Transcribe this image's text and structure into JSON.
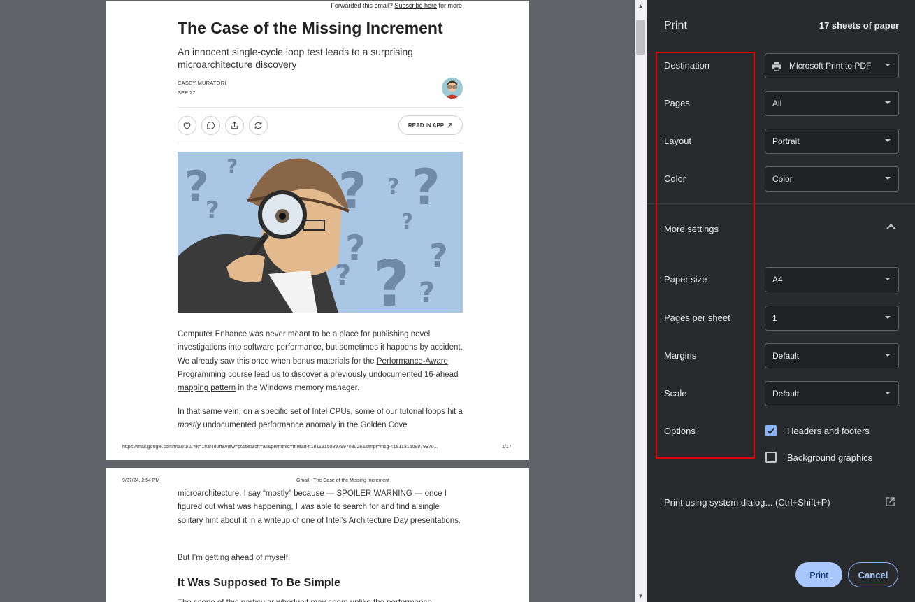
{
  "preview": {
    "page1": {
      "forwarded_prefix": "Forwarded this email?",
      "subscribe_link": "Subscribe here",
      "forwarded_suffix": "for more",
      "title": "The Case of the Missing Increment",
      "subtitle": "An innocent single-cycle loop test leads to a surprising microarchitecture discovery",
      "author": "CASEY MURATORI",
      "date": "SEP 27",
      "read_in_app": "READ IN APP",
      "para1_a": "Computer Enhance was never meant to be a place for publishing novel investigations into software performance, but sometimes it happens by accident. We already saw this once when bonus materials for the ",
      "para1_link1": "Performance-Aware Programming",
      "para1_b": " course lead us to discover ",
      "para1_link2": "a previously undocumented 16-ahead mapping pattern",
      "para1_c": " in the Windows memory manager.",
      "para2_a": "In that same vein, on a specific set of Intel CPUs, some of our tutorial loops hit a ",
      "para2_em": "mostly",
      "para2_b": " undocumented performance anomaly in the Golden Cove",
      "footer_url": "https://mail.google.com/mail/u/2/?ik=1ffaf4e2ff&view=pt&search=all&permthid=thread-f:1811315089799703026&simpl=msg-f:181131508979970...",
      "footer_page": "1/17"
    },
    "page2": {
      "header_date": "9/27/24, 2:54 PM",
      "header_title": "Gmail - The Case of the Missing Increment",
      "para1_a": "microarchitecture. I say “mostly” because — SPOILER WARNING — once I figured out what was happening, I ",
      "para1_em": "was",
      "para1_b": " able to search for and find a single solitary hint about it in a writeup of one of Intel’s Architecture Day presentations.",
      "para2": "But I’m getting ahead of myself.",
      "heading": "It Was Supposed To Be Simple",
      "para3": "The scope of this particular whodunit may seem unlike the performance"
    }
  },
  "panel": {
    "title": "Print",
    "sheets": "17 sheets of paper",
    "destination_label": "Destination",
    "destination_value": "Microsoft Print to PDF",
    "pages_label": "Pages",
    "pages_value": "All",
    "layout_label": "Layout",
    "layout_value": "Portrait",
    "color_label": "Color",
    "color_value": "Color",
    "more_settings": "More settings",
    "paper_size_label": "Paper size",
    "paper_size_value": "A4",
    "pps_label": "Pages per sheet",
    "pps_value": "1",
    "margins_label": "Margins",
    "margins_value": "Default",
    "scale_label": "Scale",
    "scale_value": "Default",
    "options_label": "Options",
    "headers_footers": "Headers and footers",
    "background_graphics": "Background graphics",
    "system_dialog": "Print using system dialog... (Ctrl+Shift+P)",
    "print_button": "Print",
    "cancel_button": "Cancel"
  },
  "colors": {
    "panel_bg": "#292a2d",
    "accent": "#8ab4f8",
    "highlight": "#e00000",
    "hero_bg": "#a9c6e4"
  },
  "state": {
    "headers_footers_checked": true,
    "background_graphics_checked": false
  }
}
